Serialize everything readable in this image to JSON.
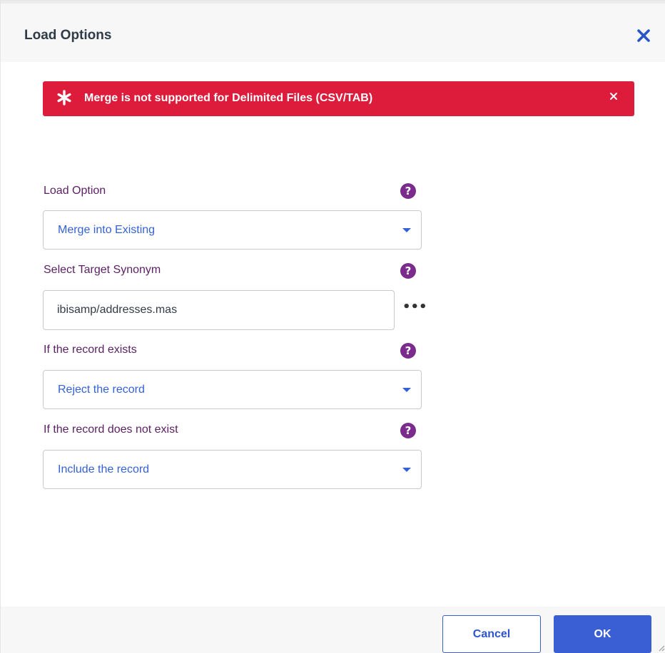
{
  "dialog": {
    "title": "Load Options",
    "close_icon": "close-icon"
  },
  "alert": {
    "icon": "asterisk-icon",
    "message": "Merge is not supported for Delimited Files (CSV/TAB)",
    "close_icon": "close-icon",
    "color": "#dc1c3a"
  },
  "fields": {
    "load_option": {
      "label": "Load Option",
      "value": "Merge into Existing",
      "help_icon": "question-circle-icon"
    },
    "target_synonym": {
      "label": "Select Target Synonym",
      "value": "ibisamp/addresses.mas",
      "browse_label": "•••",
      "help_icon": "question-circle-icon"
    },
    "record_exists": {
      "label": "If the record exists",
      "value": "Reject the record",
      "help_icon": "question-circle-icon"
    },
    "record_not_exists": {
      "label": "If the record does not exist",
      "value": "Include the record",
      "help_icon": "question-circle-icon"
    }
  },
  "footer": {
    "cancel_label": "Cancel",
    "ok_label": "OK"
  },
  "colors": {
    "accent": "#3a5ed3",
    "label": "#5b1f63",
    "help": "#7a2b8c",
    "error": "#dc1c3a"
  }
}
